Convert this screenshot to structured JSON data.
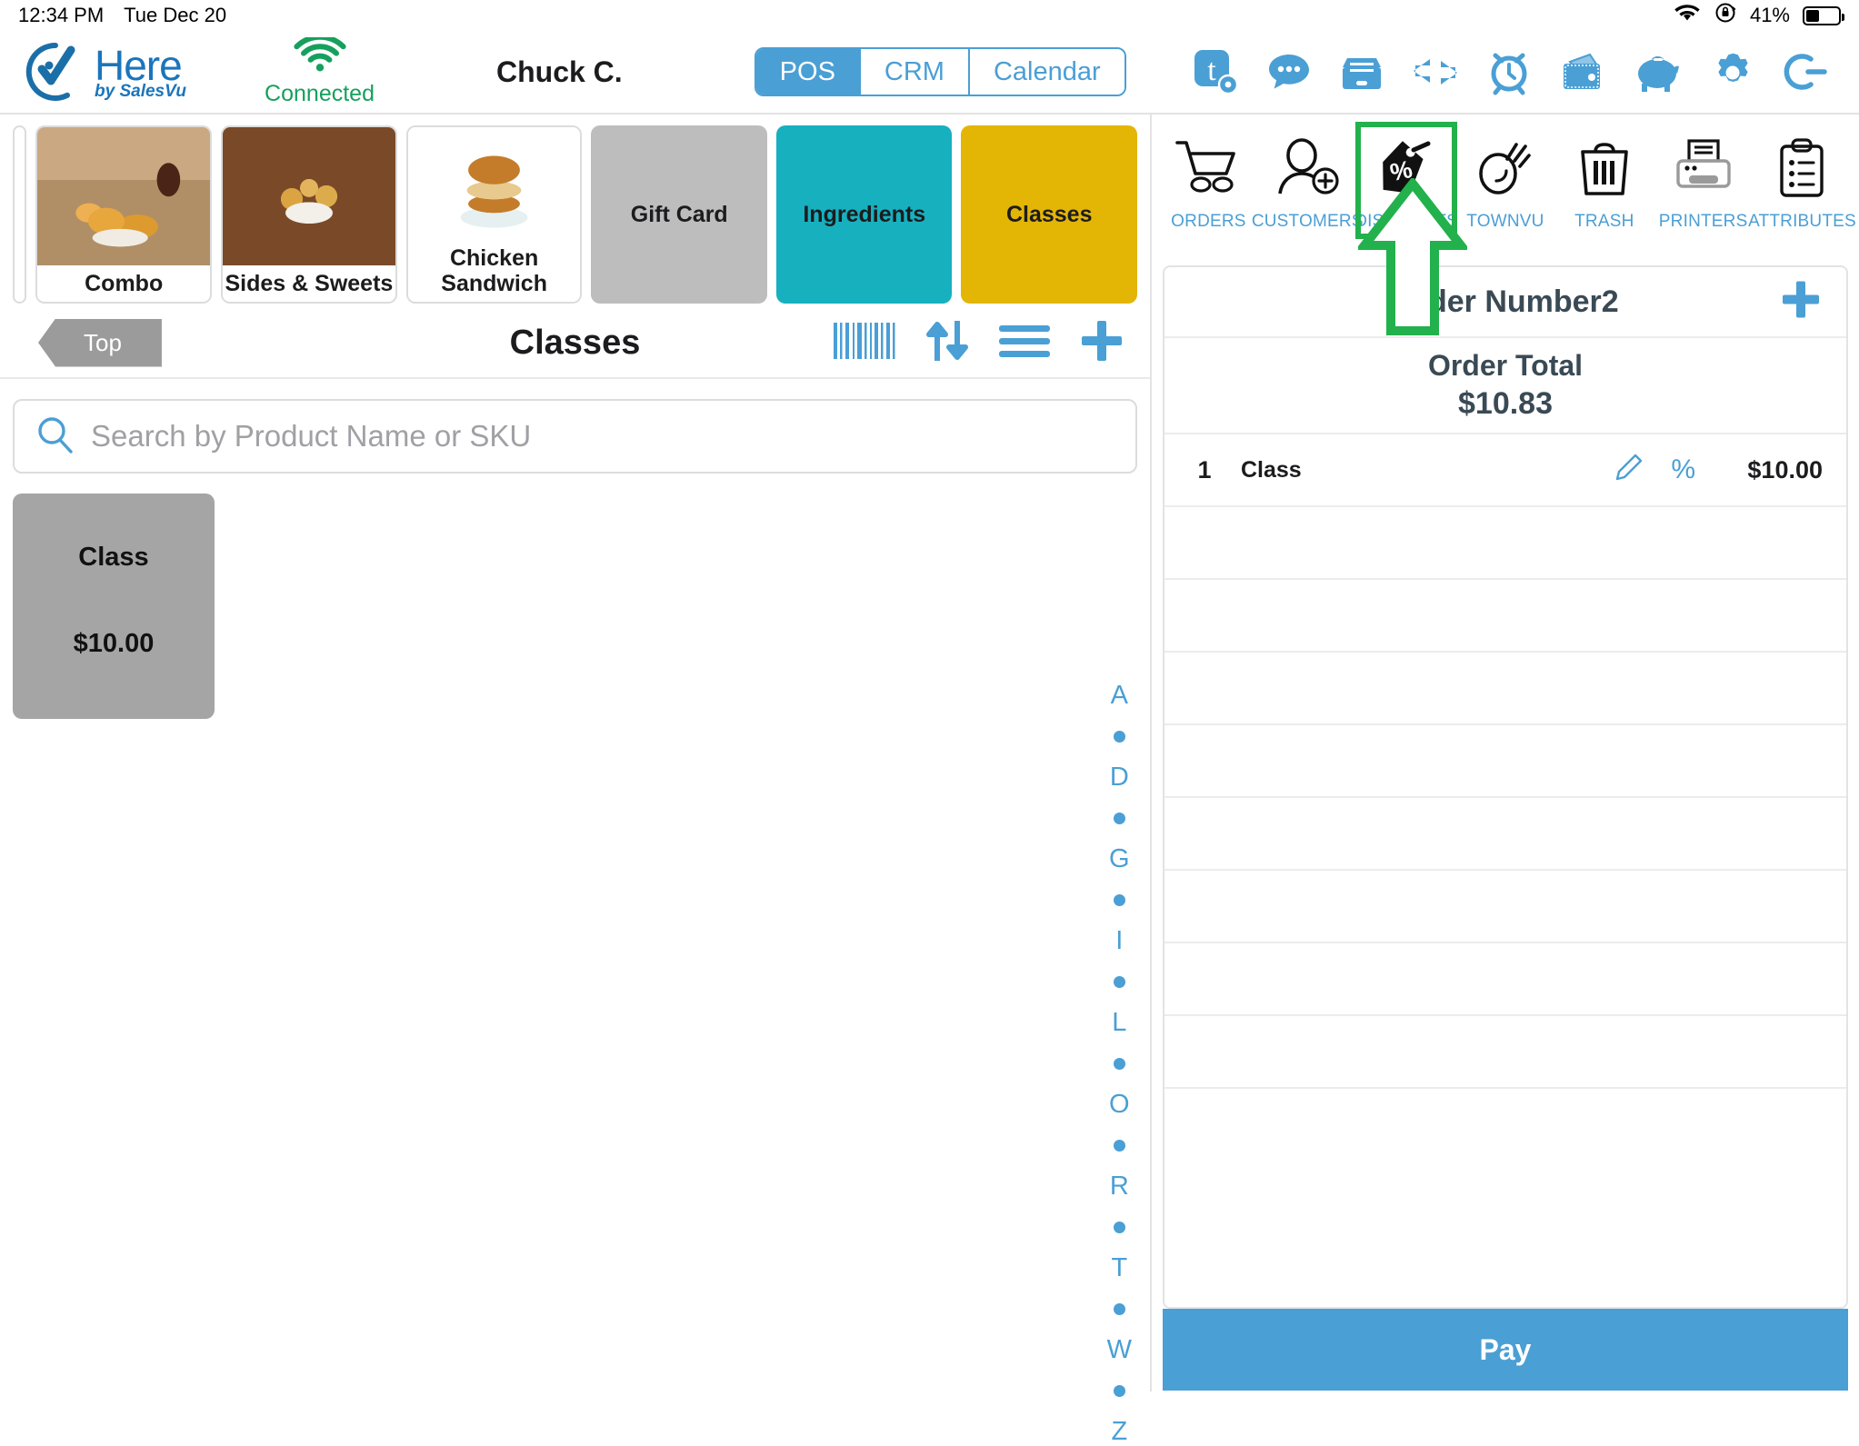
{
  "statusbar": {
    "time": "12:34 PM",
    "date": "Tue Dec 20",
    "wifi_icon": "wifi-icon",
    "lock_icon": "rotation-lock-icon",
    "battery_percent": "41%",
    "battery_icon": "battery-icon"
  },
  "header": {
    "brand_name": "Here",
    "brand_sub": "by SalesVu",
    "logo_icon": "here-logo-icon",
    "connection": {
      "icon": "wifi-signal-icon",
      "label": "Connected"
    },
    "user": "Chuck C.",
    "tabs": [
      {
        "label": "POS",
        "active": true
      },
      {
        "label": "CRM",
        "active": false
      },
      {
        "label": "Calendar",
        "active": false
      }
    ],
    "icons": [
      "ticket-settings-icon",
      "chat-bubble-icon",
      "file-box-icon",
      "transfer-arrows-icon",
      "alarm-clock-icon",
      "wallet-cash-icon",
      "piggy-bank-icon",
      "gear-icon",
      "logout-icon"
    ]
  },
  "categories": [
    {
      "label": "Combo",
      "style": "image",
      "image": "fried-chicken-combo"
    },
    {
      "label": "Sides & Sweets",
      "style": "image",
      "image": "honey-biscuits"
    },
    {
      "label": "Chicken Sandwich",
      "style": "image",
      "image": "chicken-sandwich"
    },
    {
      "label": "Gift Card",
      "style": "gray",
      "color": "#bdbdbd"
    },
    {
      "label": "Ingredients",
      "style": "teal",
      "color": "#17b0bf"
    },
    {
      "label": "Classes",
      "style": "gold",
      "color": "#e3b505"
    }
  ],
  "subnav": {
    "back_label": "Top",
    "title": "Classes",
    "icons": [
      "barcode-icon",
      "sort-icon",
      "list-menu-icon",
      "add-plus-icon"
    ]
  },
  "search": {
    "icon": "search-icon",
    "placeholder": "Search by Product Name or SKU",
    "value": ""
  },
  "products": [
    {
      "name": "Class",
      "price": "$10.00"
    }
  ],
  "alpha_index": [
    "A",
    "•",
    "D",
    "•",
    "G",
    "•",
    "I",
    "•",
    "L",
    "•",
    "O",
    "•",
    "R",
    "•",
    "T",
    "•",
    "W",
    "•",
    "Z"
  ],
  "tooltabs": [
    {
      "label": "ORDERS",
      "icon": "shopping-cart-icon",
      "selected": false
    },
    {
      "label": "CUSTOMERS",
      "icon": "add-customer-icon",
      "selected": false
    },
    {
      "label": "DISCOUNTS",
      "icon": "discount-tag-icon",
      "selected": true
    },
    {
      "label": "TOWNVU",
      "icon": "townvu-icon",
      "selected": false
    },
    {
      "label": "TRASH",
      "icon": "trash-icon",
      "selected": false
    },
    {
      "label": "PRINTERS",
      "icon": "printer-icon",
      "selected": false
    },
    {
      "label": "ATTRIBUTES",
      "icon": "clipboard-list-icon",
      "selected": false
    }
  ],
  "order": {
    "number_label": "Order Number2",
    "add_icon": "add-plus-icon",
    "total_label": "Order Total",
    "total_value": "$10.83",
    "items": [
      {
        "qty": "1",
        "name": "Class",
        "edit_icon": "pencil-icon",
        "discount_icon": "percent-icon",
        "price": "$10.00"
      }
    ],
    "empty_row_count": 8,
    "pay_label": "Pay"
  },
  "annotation": {
    "shape": "up-arrow",
    "color": "#22b14c",
    "target": "DISCOUNTS"
  },
  "colors": {
    "accent": "#4a9fd5",
    "green": "#22b14c",
    "brand": "#1b75bb"
  }
}
